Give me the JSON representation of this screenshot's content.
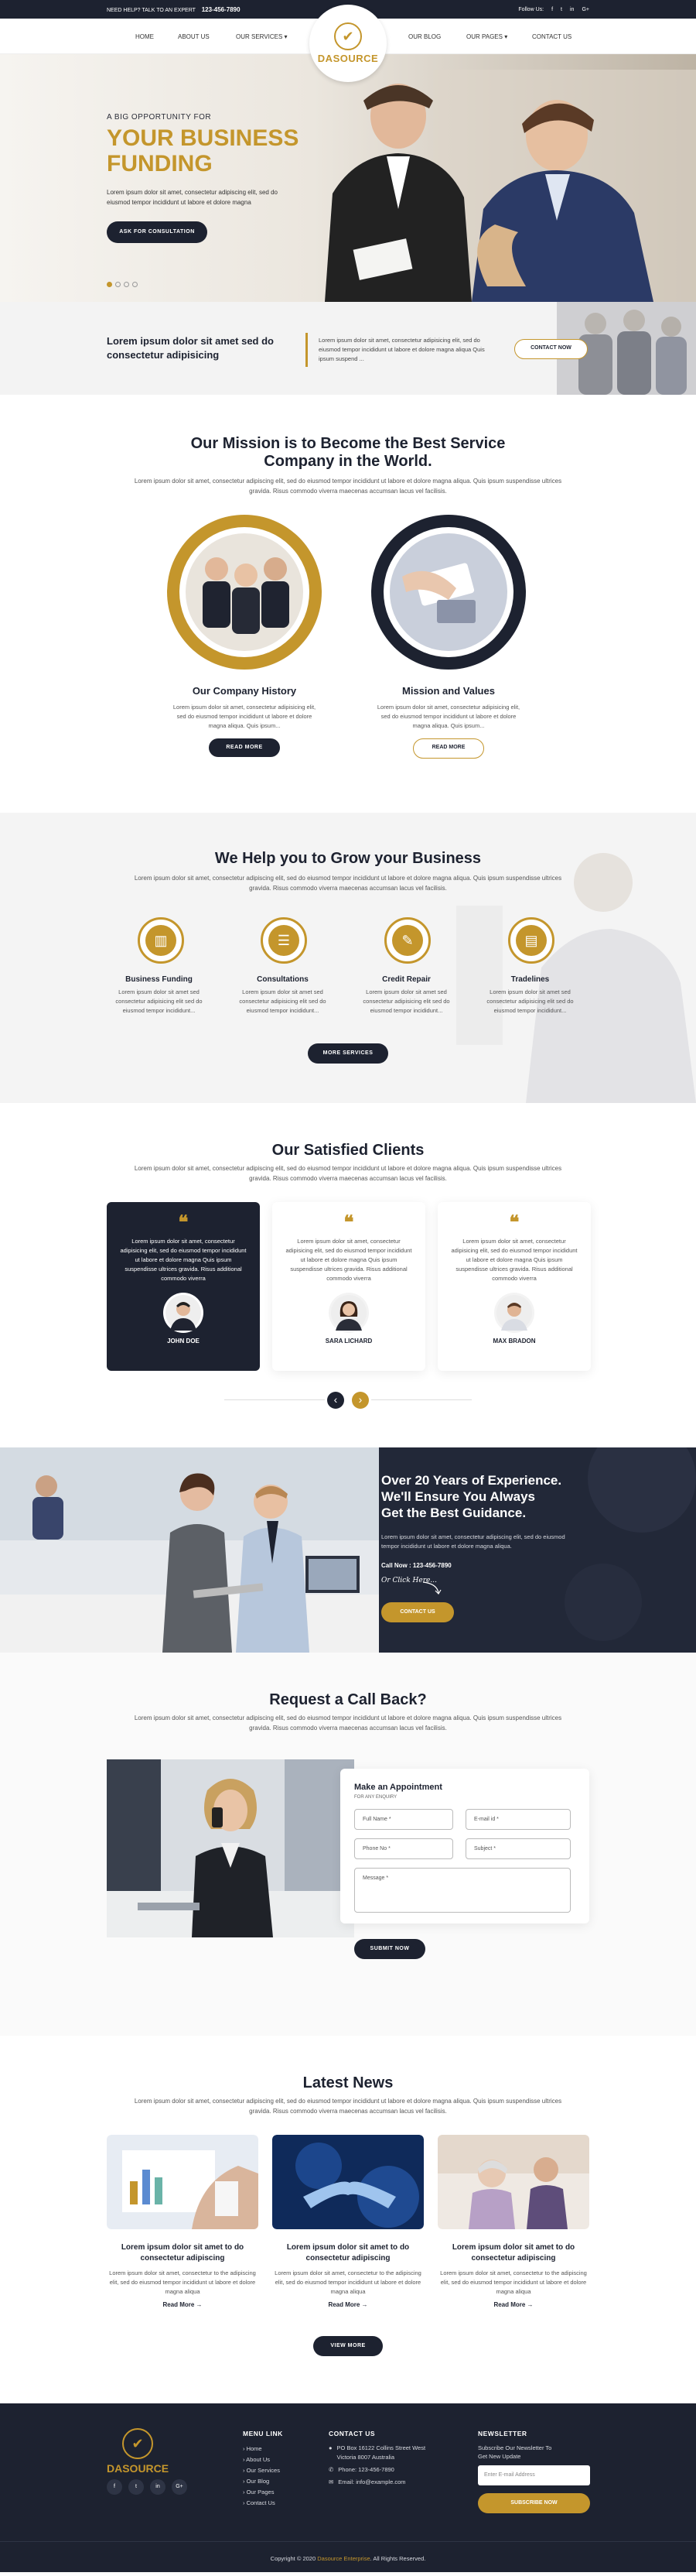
{
  "topbar": {
    "expert_label": "NEED HELP? TALK TO AN EXPERT",
    "phone": "123-456-7890",
    "follow_label": "Follow Us:",
    "social": [
      "f",
      "t",
      "in",
      "G+"
    ]
  },
  "nav": {
    "left": [
      "HOME",
      "ABOUT US",
      "OUR SERVICES ▾"
    ],
    "right": [
      "OUR BLOG",
      "OUR PAGES ▾",
      "CONTACT US"
    ],
    "logo_text": "DASOURCE"
  },
  "hero": {
    "eyebrow": "A BIG OPPORTUNITY FOR",
    "title_line1": "YOUR BUSINESS",
    "title_line2": "FUNDING",
    "text": "Lorem ipsum dolor sit amet, consectetur adipiscing elit, sed do eiusmod tempor incididunt ut labore et dolore magna",
    "cta": "ASK FOR CONSULTATION"
  },
  "callout": {
    "title": "Lorem ipsum dolor sit amet sed do consectetur adipisicing",
    "text": "Lorem ipsum dolor sit amet, consectetur adipisicing elit, sed do eiusmod tempor incididunt ut labore et dolore magna aliqua Quis ipsum suspend ...",
    "cta": "CONTACT NOW"
  },
  "mission": {
    "title_line1": "Our Mission is to Become the Best Service",
    "title_line2": "Company in the World.",
    "lead": "Lorem ipsum dolor sit amet, consectetur adipiscing elit, sed do eiusmod tempor incididunt ut labore et dolore magna aliqua. Quis ipsum suspendisse ultrices gravida. Risus commodo viverra maecenas accumsan lacus vel facilisis.",
    "cards": [
      {
        "title": "Our Company History",
        "text": "Lorem ipsum dolor sit amet, consectetur adipisicing elit, sed do eiusmod tempor incididunt ut labore et dolore magna aliqua. Quis ipsum...",
        "cta": "READ MORE"
      },
      {
        "title": "Mission and Values",
        "text": "Lorem ipsum dolor sit amet, consectetur adipisicing elit, sed do eiusmod tempor incididunt ut labore et dolore magna aliqua. Quis ipsum...",
        "cta": "READ MORE"
      }
    ]
  },
  "grow": {
    "title": "We Help you to Grow your Business",
    "lead": "Lorem ipsum dolor sit amet, consectetur adipiscing elit, sed do eiusmod tempor incididunt ut labore et dolore magna aliqua. Quis ipsum suspendisse ultrices gravida. Risus commodo viverra maecenas accumsan lacus vel facilisis.",
    "services": [
      {
        "title": "Business Funding",
        "text": "Lorem ipsum dolor sit amet sed consectetur adipisicing elit sed do eiusmod tempor incididunt..."
      },
      {
        "title": "Consultations",
        "text": "Lorem ipsum dolor sit amet sed consectetur adipisicing elit sed do eiusmod tempor incididunt..."
      },
      {
        "title": "Credit Repair",
        "text": "Lorem ipsum dolor sit amet sed consectetur adipisicing elit sed do eiusmod tempor incididunt..."
      },
      {
        "title": "Tradelines",
        "text": "Lorem ipsum dolor sit amet sed consectetur adipisicing elit sed do eiusmod tempor incididunt..."
      }
    ],
    "cta": "MORE SERVICES"
  },
  "clients": {
    "title": "Our Satisfied Clients",
    "lead": "Lorem ipsum dolor sit amet, consectetur adipiscing elit, sed do eiusmod tempor incididunt ut labore et dolore magna aliqua. Quis ipsum suspendisse ultrices gravida. Risus commodo viverra maecenas accumsan lacus vel facilisis.",
    "testimonials": [
      {
        "quote": "Lorem ipsum dolor sit amet, consectetur adipisicing elit, sed do eiusmod tempor incididunt ut labore et dolore magna Quis ipsum suspendisse ultrices gravida. Risus additional commodo viverra",
        "name": "JOHN DOE"
      },
      {
        "quote": "Lorem ipsum dolor sit amet, consectetur adipisicing elit, sed do eiusmod tempor incididunt ut labore et dolore magna Quis ipsum suspendisse ultrices gravida. Risus additional commodo viverra",
        "name": "SARA LICHARD"
      },
      {
        "quote": "Lorem ipsum dolor sit amet, consectetur adipisicing elit, sed do eiusmod tempor incididunt ut labore et dolore magna Quis ipsum suspendisse ultrices gravida. Risus additional commodo viverra",
        "name": "MAX BRADON"
      }
    ],
    "prev": "‹",
    "next": "›"
  },
  "experience": {
    "title_line1": "Over 20 Years of Experience.",
    "title_line2": "We'll Ensure You Always",
    "title_line3": "Get the Best Guidance.",
    "text": "Lorem ipsum dolor sit amet, consectetur adipiscing elit, sed do eiusmod tempor incididunt ut labore et dolore magna aliqua.",
    "call": "Call Now : 123-456-7890",
    "or": "Or Click Here...",
    "cta": "CONTACT US"
  },
  "callback": {
    "title": "Request a Call Back?",
    "lead": "Lorem ipsum dolor sit amet, consectetur adipiscing elit, sed do eiusmod tempor incididunt ut labore et dolore magna aliqua. Quis ipsum suspendisse ultrices gravida. Risus commodo viverra maecenas accumsan lacus vel facilisis.",
    "form_title": "Make an Appointment",
    "form_sub": "FOR ANY ENQUIRY",
    "fields": {
      "name": "Full Name *",
      "email": "E-mail id *",
      "phone": "Phone No *",
      "subject": "Subject *",
      "message": "Message *"
    },
    "submit": "SUBMIT NOW"
  },
  "news": {
    "title": "Latest News",
    "lead": "Lorem ipsum dolor sit amet, consectetur adipiscing elit, sed do eiusmod tempor incididunt ut labore et dolore magna aliqua. Quis ipsum suspendisse ultrices gravida. Risus commodo viverra maecenas accumsan lacus vel facilisis.",
    "items": [
      {
        "title": "Lorem ipsum dolor sit amet to do consectetur adipiscing",
        "text": "Lorem ipsum dolor sit amet, consectetur to the adipiscing elit, sed do eiusmod tempor incididunt ut labore et dolore magna aliqua",
        "more": "Read More →"
      },
      {
        "title": "Lorem ipsum dolor sit amet to do consectetur adipiscing",
        "text": "Lorem ipsum dolor sit amet, consectetur to the adipiscing elit, sed do eiusmod tempor incididunt ut labore et dolore magna aliqua",
        "more": "Read More →"
      },
      {
        "title": "Lorem ipsum dolor sit amet to do consectetur adipiscing",
        "text": "Lorem ipsum dolor sit amet, consectetur to the adipiscing elit, sed do eiusmod tempor incididunt ut labore et dolore magna aliqua",
        "more": "Read More →"
      }
    ],
    "cta": "VIEW MORE"
  },
  "footer": {
    "logo_text": "DASOURCE",
    "social": [
      "f",
      "t",
      "in",
      "G+"
    ],
    "menu_title": "MENU LINK",
    "menu": [
      "Home",
      "About Us",
      "Our Services",
      "Our Blog",
      "Our Pages",
      "Contact Us"
    ],
    "contact_title": "CONTACT US",
    "address_line1": "PO Box 16122 Collins Street West",
    "address_line2": "Victoria 8007 Australia",
    "phone": "Phone: 123-456-7890",
    "email": "Email: info@example.com",
    "newsletter_title": "NEWSLETTER",
    "newsletter_text_line1": "Subscribe Our Newsletter To",
    "newsletter_text_line2": "Get New Update",
    "newsletter_placeholder": "Enter E-mail Address",
    "subscribe": "SUBSCRIBE NOW",
    "copyright_pre": "Copyright © 2020",
    "copyright_brand": "Dasource Enterprise",
    "copyright_post": ". All Rights Reserved."
  },
  "colors": {
    "accent": "#c4962c",
    "dark": "#1d2230"
  }
}
